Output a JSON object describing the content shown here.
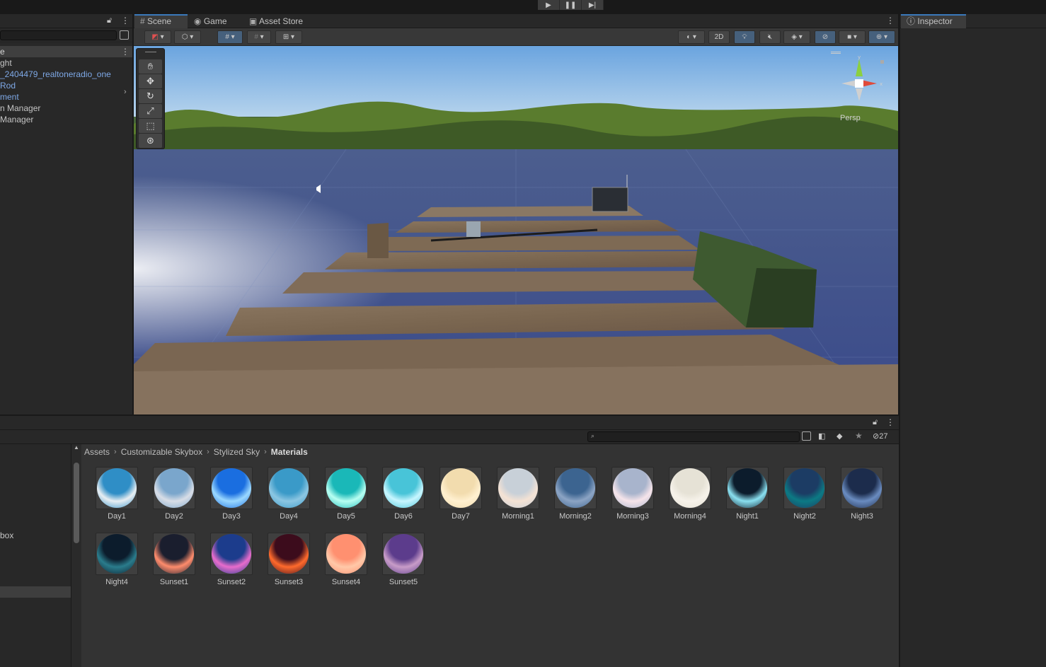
{
  "toolbar": {
    "play_icon": "play-icon",
    "pause_icon": "pause-icon",
    "step_icon": "step-icon"
  },
  "hierarchy": {
    "scene_label": "e",
    "items": [
      {
        "label": "ght",
        "color": "#c4c4c4"
      },
      {
        "label": "_2404479_realtoneradio_one",
        "color": "#7ea8e6"
      },
      {
        "label": "Rod",
        "color": "#7ea8e6"
      },
      {
        "label": "ment",
        "color": "#7ea8e6"
      },
      {
        "label": "n Manager",
        "color": "#c4c4c4"
      },
      {
        "label": "Manager",
        "color": "#c4c4c4"
      }
    ]
  },
  "scene_tabs": {
    "scene": "Scene",
    "game": "Game",
    "asset_store": "Asset Store"
  },
  "scene_toolbar": {
    "mode_2d": "2D",
    "gizmo_label": "Persp"
  },
  "inspector": {
    "title": "Inspector"
  },
  "project": {
    "hidden_count": "27",
    "left_label": "box",
    "breadcrumb": [
      "Assets",
      "Customizable Skybox",
      "Stylized Sky",
      "Materials"
    ],
    "assets": [
      {
        "name": "Day1",
        "top": "#2f8ec6",
        "bottom": "#e8eef2"
      },
      {
        "name": "Day2",
        "top": "#7aa6cc",
        "bottom": "#d8dde6"
      },
      {
        "name": "Day3",
        "top": "#1a6ee0",
        "bottom": "#9ad8ff"
      },
      {
        "name": "Day4",
        "top": "#3a9ac8",
        "bottom": "#8cc6e2"
      },
      {
        "name": "Day5",
        "top": "#1ab8b8",
        "bottom": "#b8fff2"
      },
      {
        "name": "Day6",
        "top": "#48c4d8",
        "bottom": "#c8f6ff"
      },
      {
        "name": "Day7",
        "top": "#f2dcae",
        "bottom": "#fff0d0"
      },
      {
        "name": "Morning1",
        "top": "#c8d0d8",
        "bottom": "#f4e2d4"
      },
      {
        "name": "Morning2",
        "top": "#3c6490",
        "bottom": "#8ca4c4"
      },
      {
        "name": "Morning3",
        "top": "#a8b4cc",
        "bottom": "#f6e4ea"
      },
      {
        "name": "Morning4",
        "top": "#e6e2d6",
        "bottom": "#f6f2ea"
      },
      {
        "name": "Night1",
        "top": "#0c1c2c",
        "bottom": "#8ae0f0"
      },
      {
        "name": "Night2",
        "top": "#1c3c64",
        "bottom": "#0c7a84"
      },
      {
        "name": "Night3",
        "top": "#1c2c4c",
        "bottom": "#6a8cc0"
      },
      {
        "name": "Night4",
        "top": "#0c1c2c",
        "bottom": "#2a7c8c"
      },
      {
        "name": "Sunset1",
        "top": "#1a1e2e",
        "bottom": "#ff8c6c"
      },
      {
        "name": "Sunset2",
        "top": "#1c3c8c",
        "bottom": "#e86ccc"
      },
      {
        "name": "Sunset3",
        "top": "#3c0c1c",
        "bottom": "#ff6a2c"
      },
      {
        "name": "Sunset4",
        "top": "#ff9070",
        "bottom": "#ffc8a8"
      },
      {
        "name": "Sunset5",
        "top": "#5c3c8c",
        "bottom": "#c89cc8"
      }
    ]
  },
  "colors": {
    "accent": "#3a79bb",
    "panel": "#282828",
    "toolbar": "#383838"
  }
}
